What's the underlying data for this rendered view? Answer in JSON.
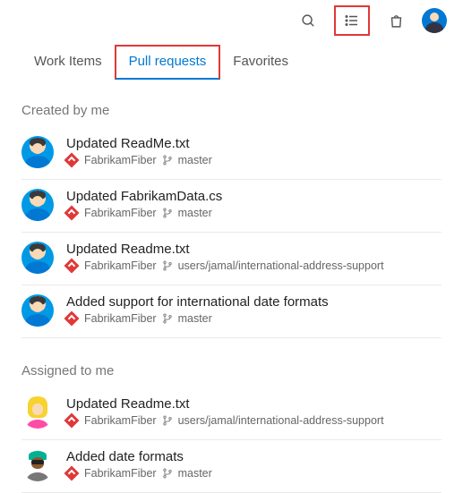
{
  "topbar": {
    "search_icon": "search-icon",
    "list_icon": "list-icon",
    "bag_icon": "shopping-bag-icon",
    "user": "current-user-avatar"
  },
  "tabs": [
    {
      "label": "Work Items",
      "active": false
    },
    {
      "label": "Pull requests",
      "active": true
    },
    {
      "label": "Favorites",
      "active": false
    }
  ],
  "sections": [
    {
      "title": "Created by me",
      "items": [
        {
          "title": "Updated ReadMe.txt",
          "repo": "FabrikamFiber",
          "branch": "master",
          "avatar": "blue"
        },
        {
          "title": "Updated FabrikamData.cs",
          "repo": "FabrikamFiber",
          "branch": "master",
          "avatar": "blue"
        },
        {
          "title": "Updated Readme.txt",
          "repo": "FabrikamFiber",
          "branch": "users/jamal/international-address-support",
          "avatar": "blue"
        },
        {
          "title": "Added support for international date formats",
          "repo": "FabrikamFiber",
          "branch": "master",
          "avatar": "blue"
        }
      ]
    },
    {
      "title": "Assigned to me",
      "items": [
        {
          "title": "Updated Readme.txt",
          "repo": "FabrikamFiber",
          "branch": "users/jamal/international-address-support",
          "avatar": "yellow"
        },
        {
          "title": "Added date formats",
          "repo": "FabrikamFiber",
          "branch": "master",
          "avatar": "green"
        }
      ]
    }
  ]
}
